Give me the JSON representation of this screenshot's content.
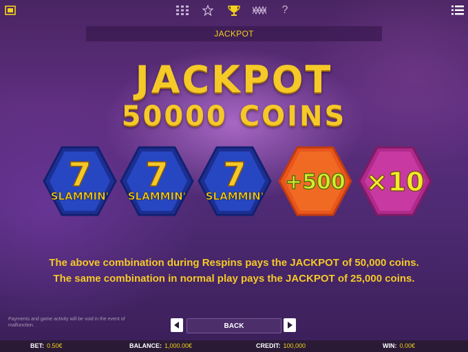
{
  "header": {
    "title": "JACKPOT"
  },
  "jackpot": {
    "line1": "JACKPOT",
    "line2": "50000 COINS"
  },
  "symbols": [
    {
      "kind": "seven",
      "label": "7",
      "sub": "SLAMMIN'"
    },
    {
      "kind": "seven",
      "label": "7",
      "sub": "SLAMMIN'"
    },
    {
      "kind": "seven",
      "label": "7",
      "sub": "SLAMMIN'"
    },
    {
      "kind": "plus",
      "label": "+500"
    },
    {
      "kind": "multiplier",
      "label": "×10"
    }
  ],
  "info": {
    "line1": "The above combination during Respins pays the JACKPOT of 50,000 coins.",
    "line2": "The same combination in normal play pays the JACKPOT of 25,000 coins."
  },
  "disclaimer": "Payments and game activity will be void in the event of malfunction.",
  "nav": {
    "back_label": "BACK"
  },
  "status": {
    "bet_label": "BET:",
    "bet_value": "0.50€",
    "balance_label": "BALANCE:",
    "balance_value": "1,000.00€",
    "credit_label": "CREDIT:",
    "credit_value": "100,000",
    "win_label": "WIN:",
    "win_value": "0.00€"
  },
  "icons": {
    "top_left": "fullscreen-icon",
    "paytable": "paytable-grid-icon",
    "favorites": "star-icon",
    "trophy": "trophy-icon",
    "lines": "paylines-icon",
    "help": "help-icon",
    "menu": "menu-icon"
  },
  "colors": {
    "accent": "#f3d21c",
    "status_bg": "#2a1a36"
  }
}
